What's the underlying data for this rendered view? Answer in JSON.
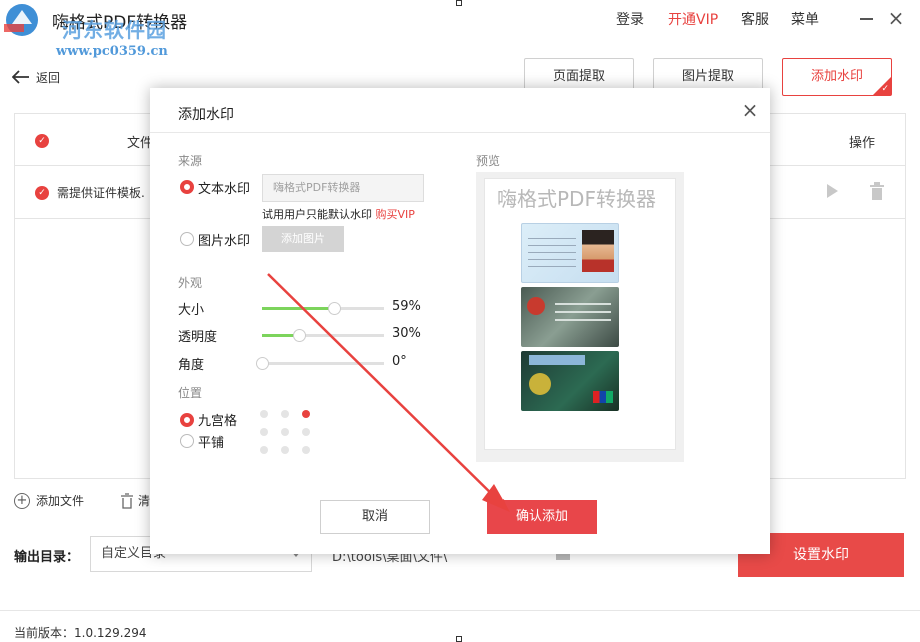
{
  "app": {
    "title": "嗨格式PDF转换器",
    "site_watermark": "河东软件园",
    "site_url": "www.pc0359.cn"
  },
  "titlebar": {
    "login": "登录",
    "vip": "开通VIP",
    "service": "客服",
    "menu": "菜单",
    "close": "×"
  },
  "nav": {
    "back": "返回"
  },
  "tabs": {
    "page_extract": "页面提取",
    "image_extract": "图片提取",
    "add_watermark": "添加水印"
  },
  "table": {
    "col_file": "文件",
    "col_action": "操作",
    "row_name": "需提供证件模板."
  },
  "bottom": {
    "add_file": "添加文件",
    "clear": "清",
    "output_label": "输出目录：",
    "output_option": "自定义目录",
    "output_path": "D:\\tools\\桌面\\文件\\",
    "set_watermark": "设置水印",
    "version": "当前版本：1.0.129.294"
  },
  "dialog": {
    "title": "添加水印",
    "close": "×",
    "source_label": "来源",
    "text_wm": "文本水印",
    "text_wm_placeholder": "嗨格式PDF转换器",
    "trial_note": "试用用户只能默认水印",
    "buy_vip": "购买VIP",
    "image_wm": "图片水印",
    "add_image": "添加图片",
    "appearance_label": "外观",
    "size_label": "大小",
    "size_value": "59%",
    "size_level": 0.59,
    "opacity_label": "透明度",
    "opacity_value": "30%",
    "opacity_level": 0.3,
    "angle_label": "角度",
    "angle_value": "0°",
    "angle_level": 0,
    "position_label": "位置",
    "grid_mode": "九宫格",
    "tile_mode": "平铺",
    "selected_cell": 2,
    "preview_label": "预览",
    "preview_watermark": "嗨格式PDF转换器",
    "cancel": "取消",
    "confirm": "确认添加"
  },
  "colors": {
    "accent": "#e8423f",
    "slider": "#7cd45c",
    "arrow": "#e8423f"
  }
}
